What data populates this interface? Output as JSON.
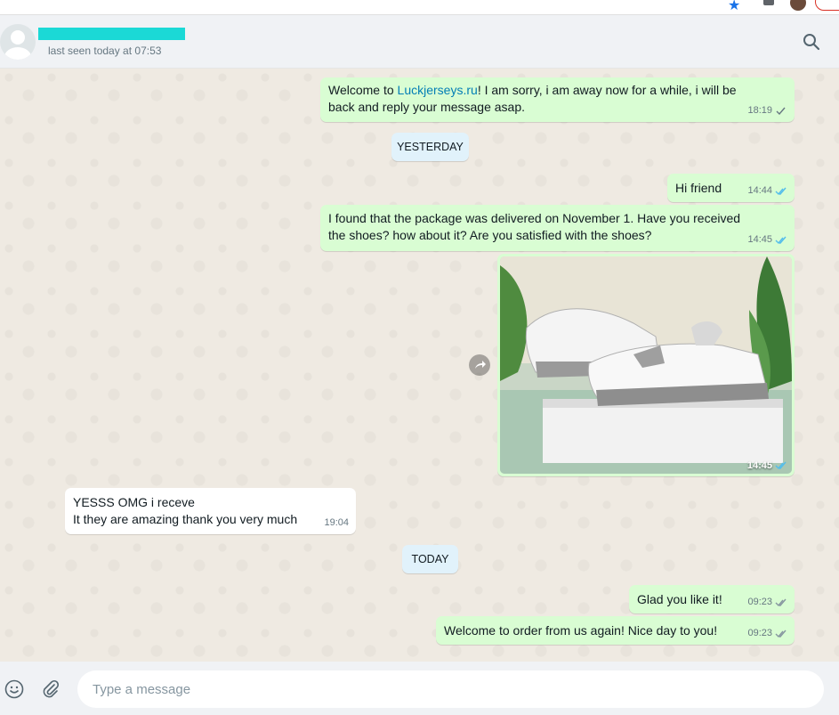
{
  "header": {
    "status": "last seen today at 07:53",
    "search_icon": "search-icon"
  },
  "messages": [
    {
      "id": "m1",
      "dir": "out",
      "pre": "Welcome to ",
      "link": "Luckjerseys.ru",
      "post": "! I am sorry, i am away now for a while, i will be back and reply your message asap.",
      "time": "18:19",
      "ticks": "single"
    },
    {
      "id": "m2",
      "dir": "out",
      "text": "Hi friend",
      "time": "14:44",
      "ticks": "double-read"
    },
    {
      "id": "m3",
      "dir": "out",
      "text": "I found that the package was delivered on November 1. Have you received the shoes? how about it? Are you  satisfied with the shoes?",
      "time": "14:45",
      "ticks": "double-read"
    },
    {
      "id": "m4",
      "dir": "out",
      "type": "image",
      "time": "14:45",
      "ticks": "double-read"
    },
    {
      "id": "m5",
      "dir": "in",
      "line1": "YESSS OMG i receve",
      "line2": "It they are amazing thank you very much",
      "time": "19:04"
    },
    {
      "id": "m6",
      "dir": "out",
      "text": "Glad you like it!",
      "time": "09:23",
      "ticks": "double-grey"
    },
    {
      "id": "m7",
      "dir": "out",
      "text": "Welcome to order from us again! Nice day to you!",
      "time": "09:23",
      "ticks": "double-grey"
    }
  ],
  "dividers": {
    "yesterday": "YESTERDAY",
    "today": "TODAY"
  },
  "composer": {
    "placeholder": "Type a message"
  },
  "colors": {
    "outgoing": "#d9fdd3",
    "incoming": "#ffffff",
    "read_tick": "#53bdeb",
    "link": "#027eb5"
  }
}
